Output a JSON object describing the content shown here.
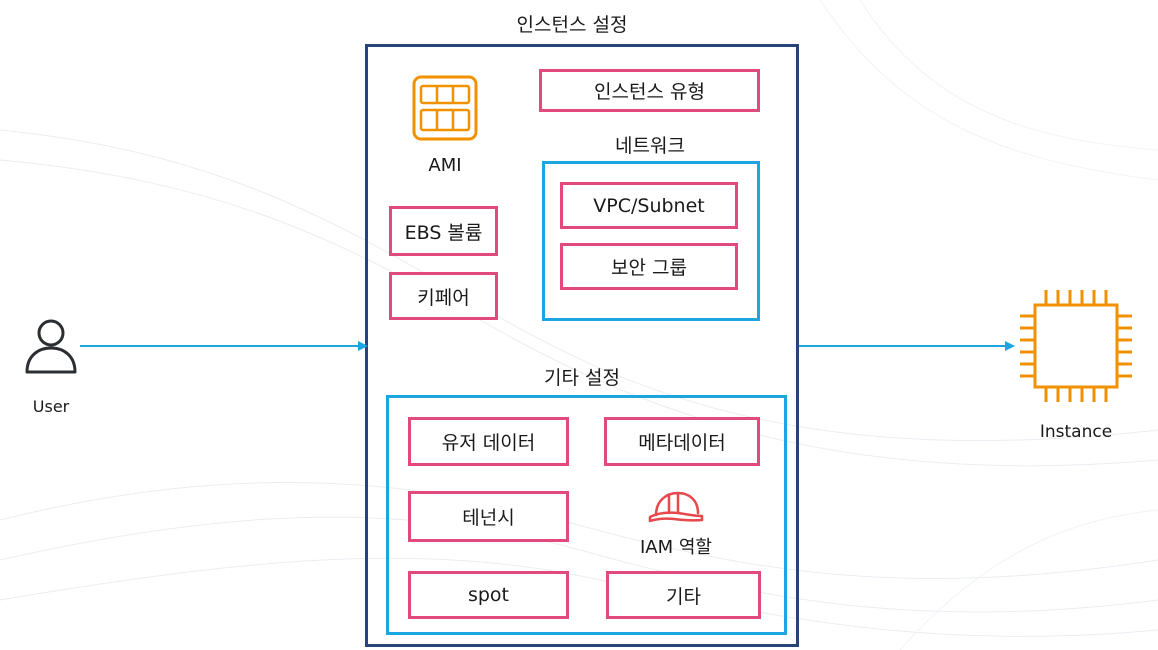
{
  "colors": {
    "frame": "#26437a",
    "pink": "#e24a7e",
    "blue": "#1ba6e0",
    "orange": "#f29100",
    "helmet": "#e8484c",
    "user": "#2b2f33"
  },
  "icons": {
    "user": "user-icon",
    "ami": "ami-icon",
    "instance": "instance-chip-icon",
    "iam": "iam-role-helmet-icon"
  },
  "diagram": {
    "title": "인스턴스 설정",
    "user_label": "User",
    "instance_label": "Instance",
    "ami_label": "AMI",
    "instance_type": "인스턴스 유형",
    "network": {
      "title": "네트워크",
      "vpc_subnet": "VPC/Subnet",
      "security_group": "보안 그룹"
    },
    "ebs_volume": "EBS 볼륨",
    "key_pair": "키페어",
    "other_settings": {
      "title": "기타 설정",
      "user_data": "유저 데이터",
      "metadata": "메타데이터",
      "tenancy": "테넌시",
      "iam_role": "IAM 역할",
      "spot": "spot",
      "other": "기타"
    }
  }
}
